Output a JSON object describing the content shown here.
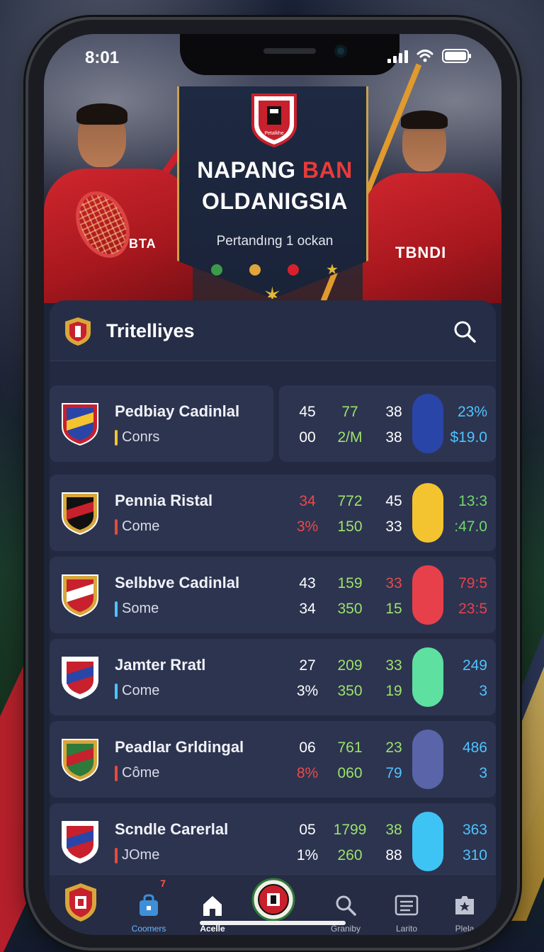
{
  "status": {
    "time": "8:01"
  },
  "hero": {
    "title_part1": "NAPANG ",
    "title_accent": "BAN",
    "title_line2": "OLDANIGSIA",
    "subtitle": "Pertandıng 1 ockan",
    "left_jersey_text": "BTA",
    "right_jersey_text": "TBNDI",
    "crest_caption": "Petalkhe"
  },
  "list": {
    "title": "Tritelliyes",
    "rows": [
      {
        "name": "Pedbiay Cadinlal",
        "tag": "Conrs",
        "tag_color": "#f4c430",
        "s1": "45",
        "s2": "77",
        "s3": "38",
        "s4": "00",
        "s5": "2/M",
        "s6": "38",
        "pill_color": "#2a45a8",
        "p1": "23%",
        "p2": "$19.0",
        "pct_color": "#4ec3ff",
        "c1": "#ffffff",
        "c2": "#9be36b",
        "c3": "#ffffff",
        "c4": "#ffffff",
        "c5": "#9be36b",
        "c6": "#ffffff"
      },
      {
        "name": "Pennia Ristal",
        "tag": "Come",
        "tag_color": "#e84a3a",
        "s1": "34",
        "s2": "772",
        "s3": "45",
        "s4": "3%",
        "s5": "150",
        "s6": "33",
        "pill_color": "#f4c430",
        "p1": "13:3",
        "p2": ":47.0",
        "pct_color": "#6fd86a",
        "c1": "#e84a4a",
        "c2": "#9be36b",
        "c3": "#ffffff",
        "c4": "#e84a4a",
        "c5": "#9be36b",
        "c6": "#ffffff"
      },
      {
        "name": "Selbbve Cadinlal",
        "tag": "Some",
        "tag_color": "#4ec3ff",
        "s1": "43",
        "s2": "159",
        "s3": "33",
        "s4": "34",
        "s5": "350",
        "s6": "15",
        "pill_color": "#e8404a",
        "p1": "79:5",
        "p2": "23:5",
        "pct_color": "#e8404a",
        "c1": "#ffffff",
        "c2": "#9be36b",
        "c3": "#e84a4a",
        "c4": "#ffffff",
        "c5": "#9be36b",
        "c6": "#9be36b"
      },
      {
        "name": "Jamter Rratl",
        "tag": "Come",
        "tag_color": "#4ec3ff",
        "s1": "27",
        "s2": "209",
        "s3": "33",
        "s4": "3%",
        "s5": "350",
        "s6": "19",
        "pill_color": "#5ee0a0",
        "p1": "249",
        "p2": "3",
        "pct_color": "#4ec3ff",
        "c1": "#ffffff",
        "c2": "#9be36b",
        "c3": "#9be36b",
        "c4": "#ffffff",
        "c5": "#9be36b",
        "c6": "#9be36b"
      },
      {
        "name": "Peadlar Grldingal",
        "tag": "Côme",
        "tag_color": "#e84a3a",
        "s1": "06",
        "s2": "761",
        "s3": "23",
        "s4": "8%",
        "s5": "060",
        "s6": "79",
        "pill_color": "#5a64a8",
        "p1": "486",
        "p2": "3",
        "pct_color": "#4ec3ff",
        "c1": "#ffffff",
        "c2": "#9be36b",
        "c3": "#9be36b",
        "c4": "#e84a4a",
        "c5": "#9be36b",
        "c6": "#4ec3ff"
      },
      {
        "name": "Scndle Carerlal",
        "tag": "JOme",
        "tag_color": "#e84a3a",
        "s1": "05",
        "s2": "1799",
        "s3": "38",
        "s4": "1%",
        "s5": "260",
        "s6": "88",
        "pill_color": "#3ec4f4",
        "p1": "363",
        "p2": "310",
        "pct_color": "#4ec3ff",
        "c1": "#ffffff",
        "c2": "#9be36b",
        "c3": "#9be36b",
        "c4": "#ffffff",
        "c5": "#9be36b",
        "c6": "#ffffff"
      }
    ]
  },
  "nav": {
    "items": [
      {
        "label": "",
        "icon": "club-crest-icon"
      },
      {
        "label": "Coomers",
        "icon": "bag-icon",
        "badge": "7"
      },
      {
        "label": "Acelle",
        "icon": "home-icon"
      },
      {
        "label": "",
        "icon": "center-crest-icon"
      },
      {
        "label": "Graniby",
        "icon": "search-icon"
      },
      {
        "label": "Larito",
        "icon": "list-icon"
      },
      {
        "label": "Plela",
        "icon": "star-tag-icon"
      }
    ]
  },
  "colors": {
    "accent_red": "#e83a3a",
    "gold": "#c9a24c",
    "card_bg": "#222941"
  }
}
